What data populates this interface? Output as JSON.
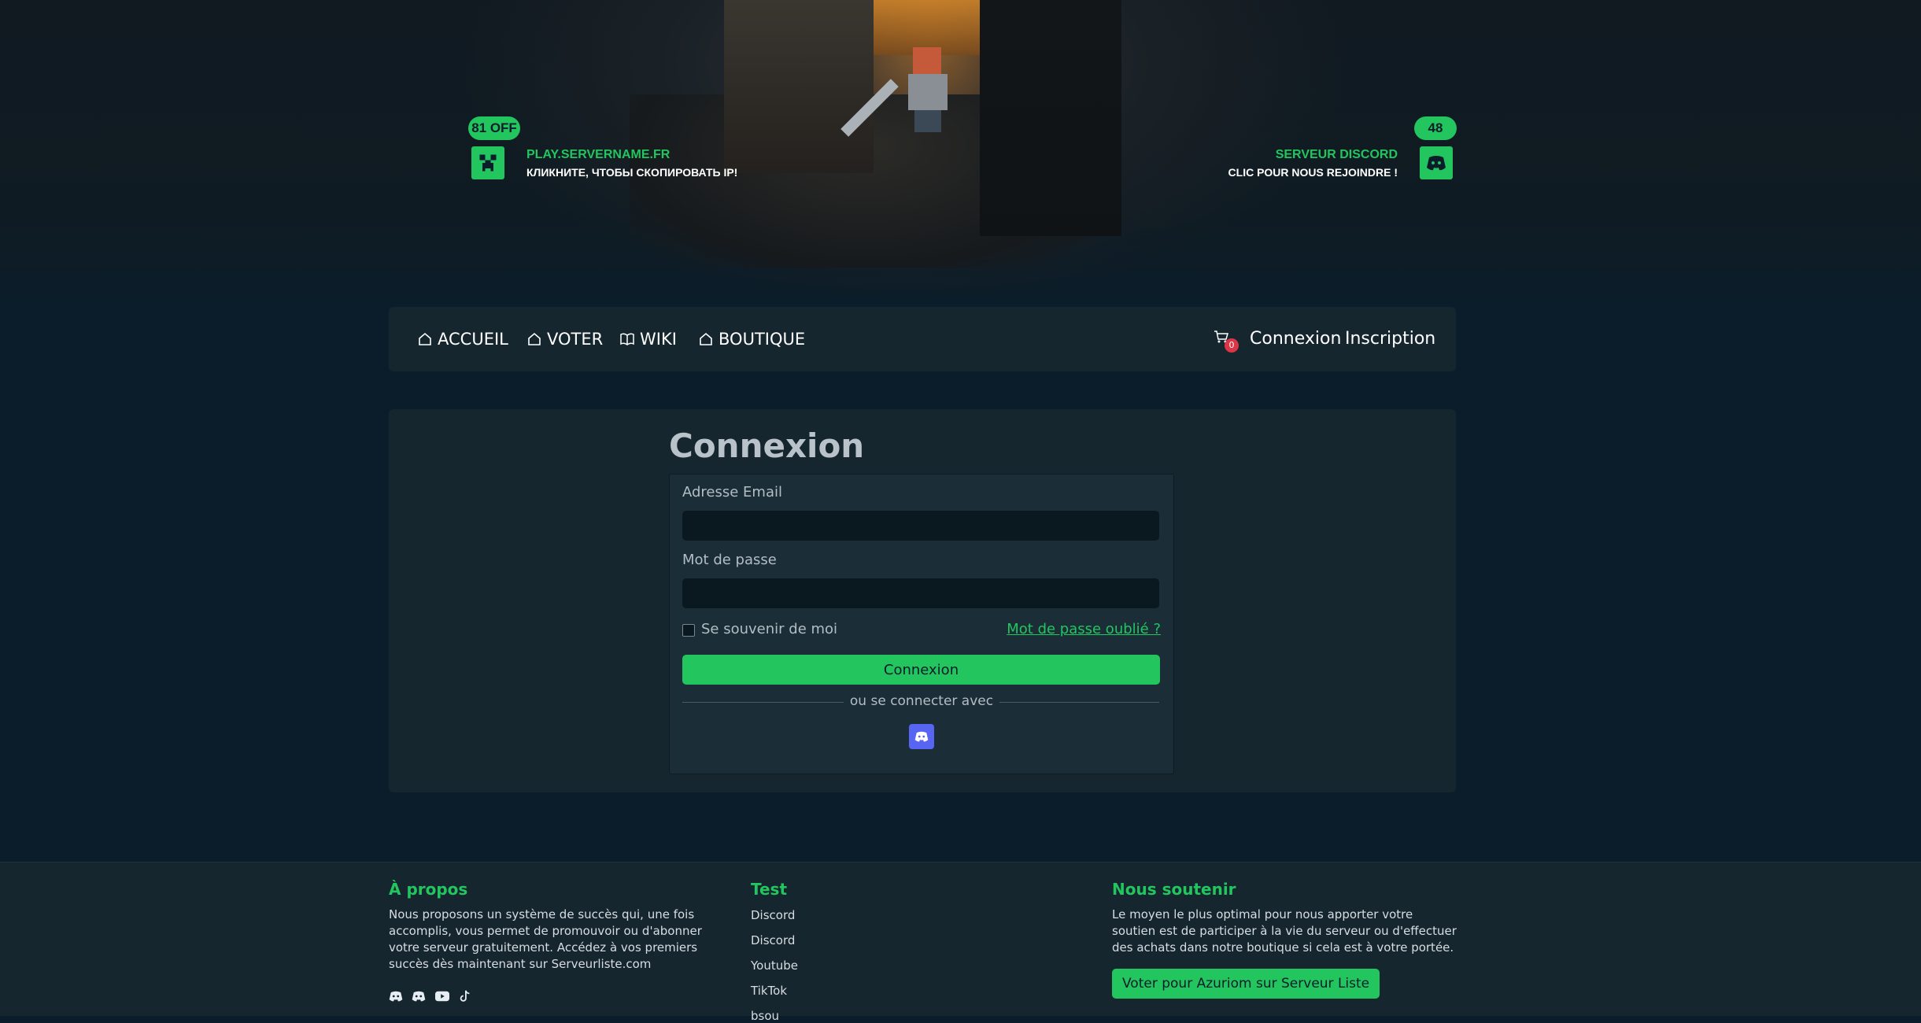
{
  "hero": {
    "server": {
      "badge": "81 OFF",
      "title": "PLAY.SERVERNAME.FR",
      "subtitle": "КЛИКНИТЕ, ЧТОБЫ СКОПИРОВАТЬ IP!",
      "icon": "creeper-icon"
    },
    "discord": {
      "badge": "48",
      "title": "SERVEUR DISCORD",
      "subtitle": "CLIC POUR NOUS REJOINDRE !",
      "icon": "discord-icon"
    }
  },
  "navbar": {
    "items": [
      {
        "label": "ACCUEIL",
        "icon": "home-icon"
      },
      {
        "label": "VOTER",
        "icon": "home-icon"
      },
      {
        "label": "WIKI",
        "icon": "book-icon"
      },
      {
        "label": "BOUTIQUE",
        "icon": "home-icon"
      }
    ],
    "cart_count": "0",
    "login": "Connexion",
    "register": "Inscription"
  },
  "login": {
    "title": "Connexion",
    "email_label": "Adresse Email",
    "email_value": "",
    "password_label": "Mot de passe",
    "password_value": "",
    "remember_label": "Se souvenir de moi",
    "forgot_label": "Mot de passe oublié ?",
    "submit_label": "Connexion",
    "separator": "ou se connecter avec"
  },
  "footer": {
    "about": {
      "title": "À propos",
      "text": "Nous proposons un système de succès qui, une fois accomplis, vous permet de promouvoir ou d'abonner votre serveur gratuitement. Accédez à vos premiers succès dès maintenant sur Serveurliste.com",
      "socials": [
        "discord-icon",
        "discord-icon",
        "youtube-icon",
        "tiktok-icon"
      ]
    },
    "links": {
      "title": "Test",
      "items": [
        "Discord",
        "Discord",
        "Youtube",
        "TikTok",
        "bsou"
      ]
    },
    "support": {
      "title": "Nous soutenir",
      "text": "Le moyen le plus optimal pour nous apporter votre soutien est de participer à la vie du serveur ou d'effectuer des achats dans notre boutique si cela est à votre portée.",
      "button": "Voter pour Azuriom sur Serveur Liste"
    }
  },
  "colors": {
    "accent": "#22c55e",
    "background": "#0b1d2a",
    "card": "#16262f",
    "discord": "#5865f2",
    "danger": "#dc3545"
  }
}
